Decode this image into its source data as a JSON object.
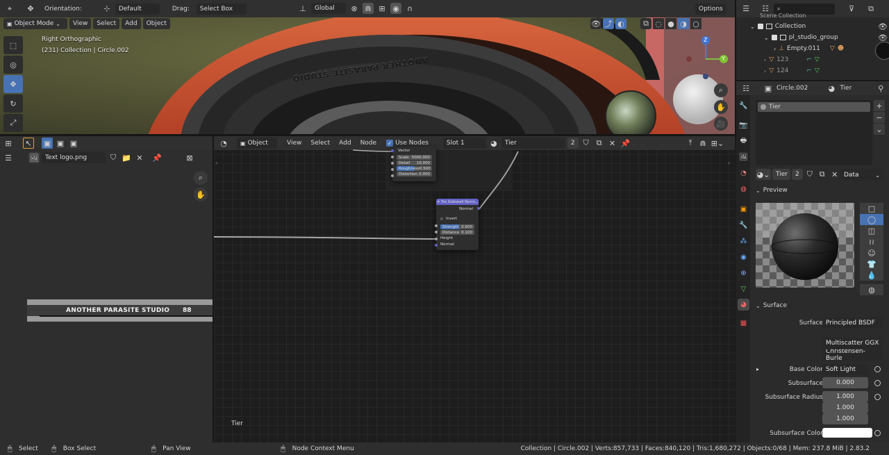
{
  "top_header": {
    "orientation_label": "Orientation:",
    "orientation_value": "Default",
    "drag_label": "Drag:",
    "drag_value": "Select Box",
    "transform_space": "Global",
    "options_label": "Options"
  },
  "viewport": {
    "mode": "Object Mode",
    "menus": [
      "View",
      "Select",
      "Add",
      "Object"
    ],
    "view_name": "Right Orthographic",
    "collection_info": "(231) Collection | Circle.002",
    "tire_text": "ANOTHER PARASITE STUDIO",
    "gizmo_axes": [
      "Z",
      "Y"
    ]
  },
  "outliner": {
    "scene_collection": "Scene Collection",
    "items": [
      {
        "label": "Collection"
      },
      {
        "label": "pl_studio_group"
      },
      {
        "label": "Empty.011"
      },
      {
        "label": "123"
      },
      {
        "label": "124"
      }
    ]
  },
  "image_editor": {
    "image_name": "Text logo.png",
    "logo_text": "ANOTHER PARASITE STUDIO",
    "logo_number": "88"
  },
  "node_editor": {
    "editor_type": "Object",
    "menus": [
      "View",
      "Select",
      "Add",
      "Node"
    ],
    "use_nodes_label": "Use Nodes",
    "slot": "Slot 1",
    "material_name": "Tier",
    "users": "2",
    "footer_label": "Tier",
    "noise_node": {
      "vector": "Vector",
      "scale_label": "Scale",
      "scale_value": "5000.000",
      "detail_label": "Detail",
      "detail_value": "10.000",
      "roughness_label": "Roughness",
      "roughness_value": "0.500",
      "distortion_label": "Distortion",
      "distortion_value": "0.000"
    },
    "bump_node": {
      "title": "Tre Sidewall Norm...",
      "normal_out": "Normal",
      "invert_label": "Invert",
      "strength_label": "Strength",
      "strength_value": "0.600",
      "distance_label": "Distance",
      "distance_value": "0.100",
      "height_label": "Height",
      "normal_in": "Normal"
    }
  },
  "properties": {
    "object_name": "Circle.002",
    "material_name": "Tier",
    "slot_material": "Tier",
    "material_field": "Tier",
    "users": "2",
    "link_mode": "Data",
    "preview_label": "Preview",
    "surface_section": "Surface",
    "surface_label": "Surface",
    "surface_value": "Principled BSDF",
    "distribution": "Multiscatter GGX",
    "subsurface_method": "Christensen-Burle",
    "base_color_label": "Base Color",
    "base_color_value": "Soft Light",
    "subsurface_label": "Subsurface",
    "subsurface_value": "0.000",
    "subsurface_radius_label": "Subsurface Radius",
    "subsurface_radius": [
      "1.000",
      "1.000",
      "1.000"
    ],
    "subsurface_color_label": "Subsurface Color"
  },
  "status_bar": {
    "select": "Select",
    "box_select": "Box Select",
    "pan_view": "Pan View",
    "context_menu": "Node Context Menu",
    "stats": "Collection | Circle.002 | Verts:857,733 | Faces:840,120 | Tris:1,680,272 | Objects:0/68 | Mem: 237.8 MiB | 2.83.2"
  },
  "colors": {
    "accent": "#4772b3",
    "header": "#303030",
    "panel": "#2b2b2b",
    "tire_red": "#b4452a",
    "node_purple": "#6363c7"
  }
}
